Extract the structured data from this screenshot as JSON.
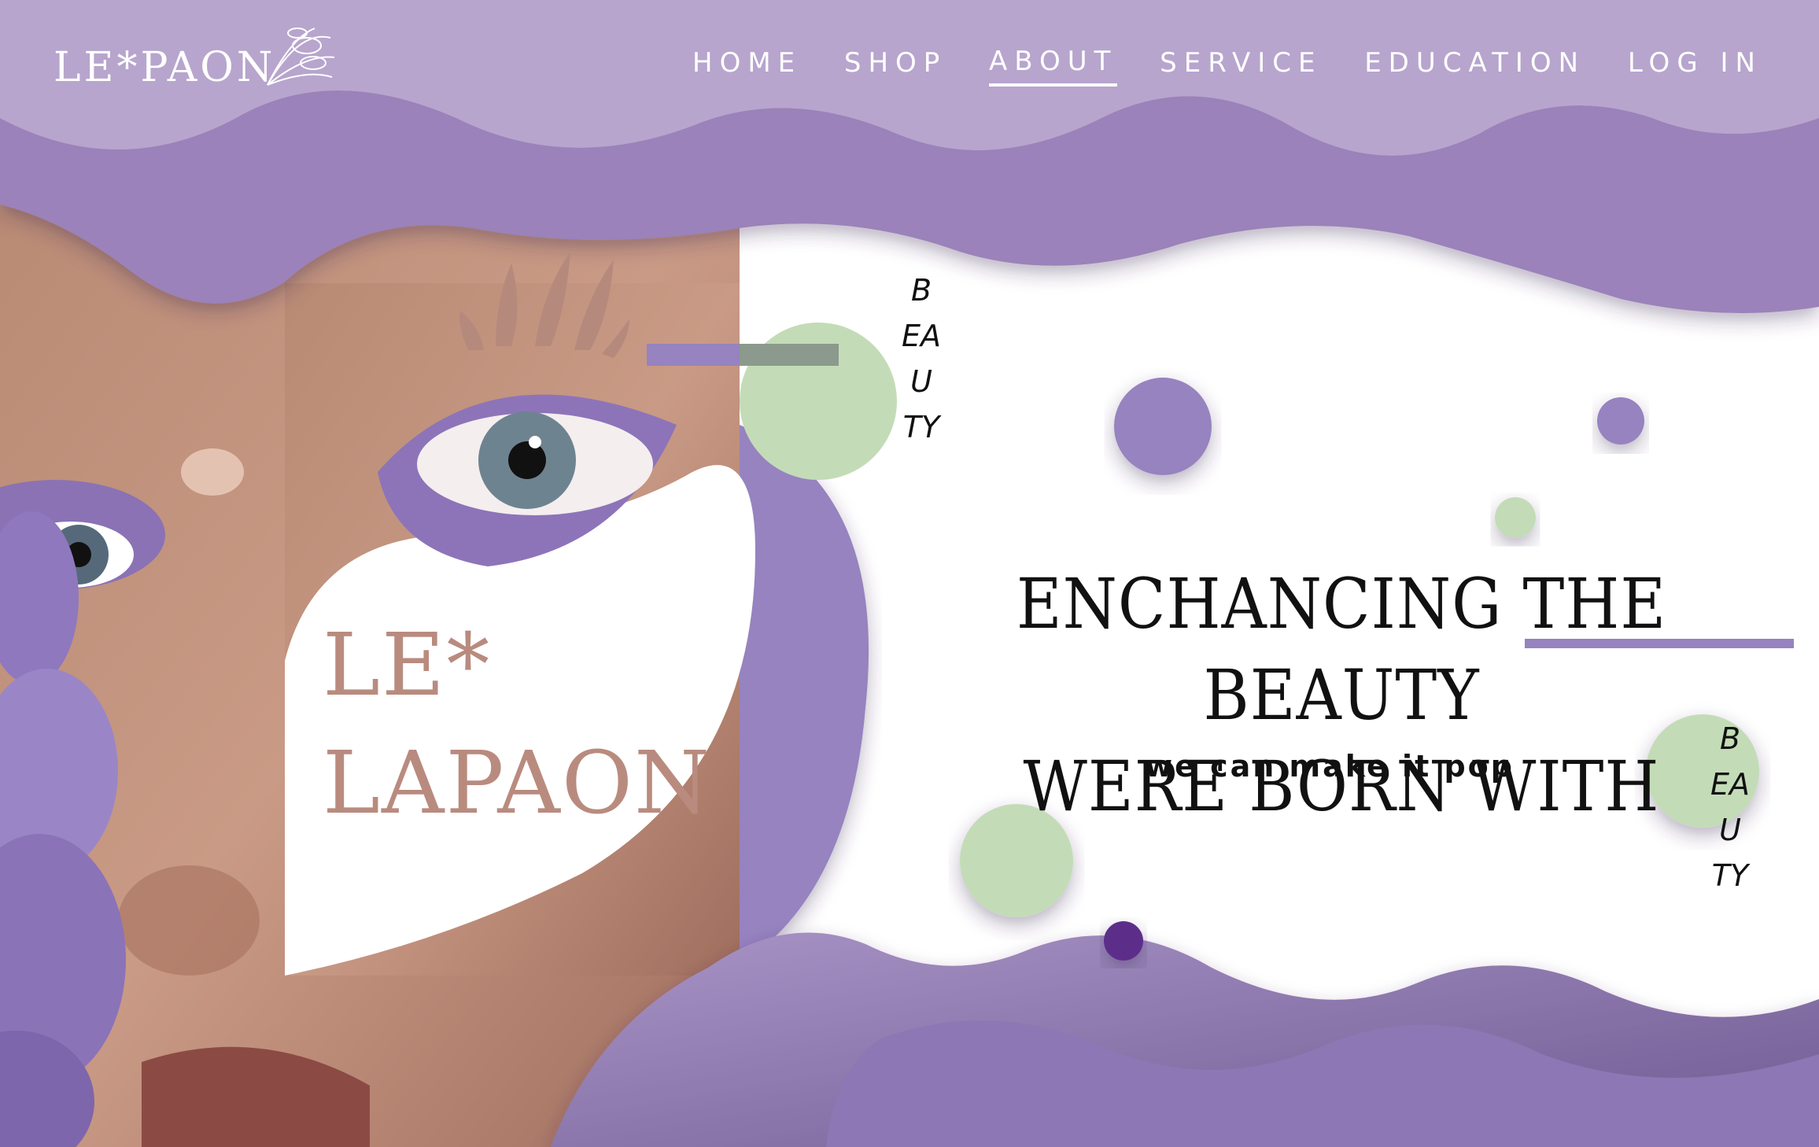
{
  "brand": {
    "logo_text": "LE*PAON"
  },
  "nav": {
    "items": [
      {
        "label": "HOME",
        "active": false
      },
      {
        "label": "SHOP",
        "active": false
      },
      {
        "label": "ABOUT",
        "active": true
      },
      {
        "label": "SERVICE",
        "active": false
      },
      {
        "label": "EDUCATION",
        "active": false
      },
      {
        "label": "LOG IN",
        "active": false
      }
    ]
  },
  "hero": {
    "headline_line1": "ENCHANCING THE BEAUTY",
    "headline_line2": "WERE BORN WITH",
    "tagline": "we can make it pop",
    "vertical_word_1": "BEAUTY",
    "vertical_word_2": "BEAUTY"
  },
  "card": {
    "brand_line1": "LE*",
    "brand_line2": "LAPAON"
  },
  "colors": {
    "header_bg": "#b7a5cd",
    "wave_mid": "#9b82ba",
    "wave_dark": "#8d77b4",
    "accent_purple": "#9683bf",
    "dot_green": "#c3dcb7",
    "dot_deep": "#5c2f8a",
    "brand_bronze": "#b98b7f"
  },
  "icons": {
    "logo_mark": "peacock-feather-icon",
    "card_crown": "feather-crown-icon"
  }
}
